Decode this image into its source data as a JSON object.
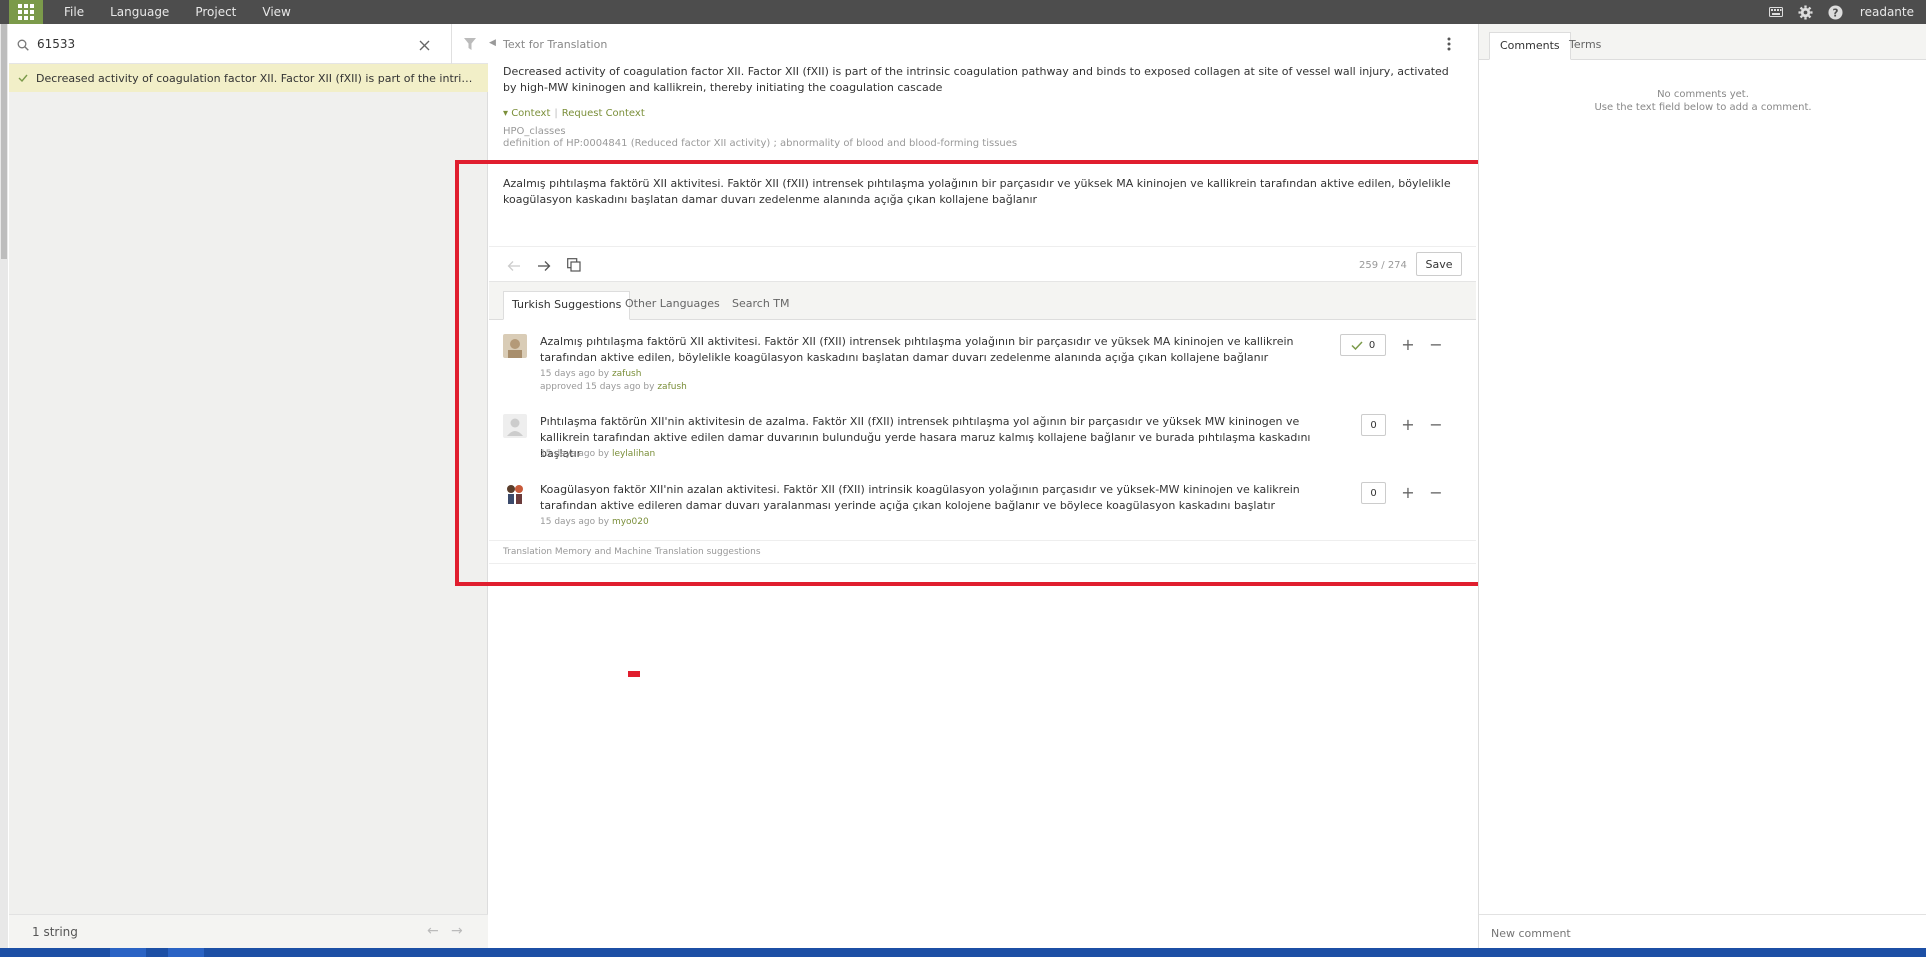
{
  "app": {
    "menu": [
      "File",
      "Language",
      "Project",
      "View"
    ],
    "username": "readante"
  },
  "left": {
    "search_value": "61533",
    "string_item": "Decreased activity of coagulation factor XII. Factor XII (fXII) is part of the intrinsic coagulation pat...",
    "count": "1 string"
  },
  "middle": {
    "section_title": "Text for Translation",
    "source_text": "Decreased activity of coagulation factor XII. Factor XII (fXII) is part of the intrinsic coagulation pathway and binds to exposed collagen at site of vessel wall injury, activated by high-MW kininogen and kallikrein, thereby initiating the coagulation cascade",
    "context_label": "Context",
    "request_context_label": "Request Context",
    "meta_file": "HPO_classes",
    "meta_definition": "definition of HP:0004841 (Reduced factor XII activity) ; abnormality of blood and blood-forming tissues",
    "target_text": "Azalmış pıhtılaşma faktörü XII aktivitesi. Faktör XII (fXII) intrensek pıhtılaşma yolağının bir parçasıdır ve yüksek MA kininojen ve kallikrein tarafından aktive edilen, böylelikle koagülasyon kaskadını başlatan damar duvarı zedelenme alanında açığa çıkan kollajene bağlanır",
    "char_count": "259 / 274",
    "save_label": "Save",
    "tabs": [
      "Turkish Suggestions",
      "Other Languages",
      "Search TM"
    ],
    "suggestions": [
      {
        "text": "Azalmış pıhtılaşma faktörü XII aktivitesi. Faktör XII (fXII) intrensek pıhtılaşma yolağının bir parçasıdır ve yüksek MA kininojen ve kallikrein tarafından aktive edilen, böylelikle koagülasyon kaskadını başlatan damar duvarı zedelenme alanında açığa çıkan kollajene bağlanır",
        "time": "15 days ago by",
        "user": "zafush",
        "approved_prefix": "approved 15 days ago by",
        "approved_user": "zafush",
        "votes": "0"
      },
      {
        "text": "Pıhtılaşma faktörün XII'nin aktivitesin de azalma. Faktör XII (fXII) intrensek pıhtılaşma yol ağının bir parçasıdır ve yüksek MW kininogen ve kallikrein tarafından aktive edilen damar duvarının bulunduğu yerde hasara maruz kalmış kollajene bağlanır ve burada pıhtılaşma kaskadını başlatır",
        "time": "15 days ago by",
        "user": "leylalihan",
        "votes": "0"
      },
      {
        "text": "Koagülasyon faktör XII'nin azalan aktivitesi. Faktör XII (fXII) intrinsik koagülasyon yolağının parçasıdır ve yüksek-MW kininojen ve kalikrein tarafından aktive edileren damar duvarı yaralanması yerinde açığa çıkan kolojene bağlanır ve böylece koagülasyon kaskadını başlatır",
        "time": "15 days ago by",
        "user": "myo020",
        "votes": "0"
      }
    ],
    "tm_note": "Translation Memory and Machine Translation suggestions"
  },
  "right": {
    "tabs": [
      "Comments",
      "Terms"
    ],
    "no_comments_1": "No comments yet.",
    "no_comments_2": "Use the text field below to add a comment.",
    "new_comment_placeholder": "New comment"
  },
  "colors": {
    "accent_green": "#7b9a4a",
    "link_green": "#7b8f3a",
    "highlight_red": "#e01e2e",
    "selected_row": "#f2efc8"
  }
}
